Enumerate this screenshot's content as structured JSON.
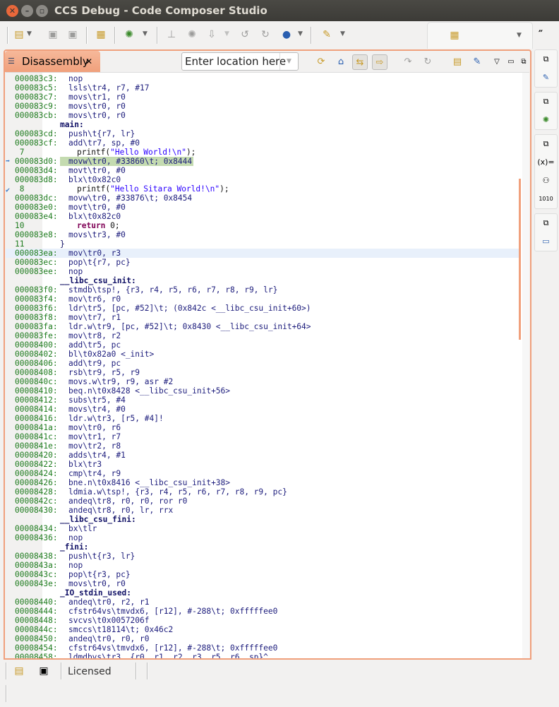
{
  "window": {
    "title": "CCS Debug - Code Composer Studio"
  },
  "view": {
    "tab_label": "Disassembly",
    "location_placeholder": "Enter location here"
  },
  "status": {
    "license": "Licensed"
  },
  "rows": [
    [
      "000083c3:",
      "nop",
      "i"
    ],
    [
      "000083c5:",
      "lsls\\tr4, r7, #17",
      "i"
    ],
    [
      "000083c7:",
      "movs\\tr1, r0",
      "i"
    ],
    [
      "000083c9:",
      "movs\\tr0, r0",
      "i"
    ],
    [
      "000083cb:",
      "movs\\tr0, r0",
      "i"
    ],
    [
      "",
      "main:",
      "l"
    ],
    [
      "000083cd:",
      "push\\t{r7, lr}",
      "i"
    ],
    [
      "000083cf:",
      "add\\tr7, sp, #0",
      "i"
    ],
    [
      " 7",
      "printf(\"Hello World!\\n\");",
      "s"
    ],
    [
      "000083d0:",
      "movw\\tr0, #33860\\t; 0x8444",
      "pc"
    ],
    [
      "000083d4:",
      "movt\\tr0, #0",
      "i"
    ],
    [
      "000083d8:",
      "blx\\t0x82c0",
      "i"
    ],
    [
      " 8",
      "printf(\"Hello Sitara World!\\n\");",
      "s"
    ],
    [
      "000083dc:",
      "movw\\tr0, #33876\\t; 0x8454",
      "i"
    ],
    [
      "000083e0:",
      "movt\\tr0, #0",
      "i"
    ],
    [
      "000083e4:",
      "blx\\t0x82c0",
      "i"
    ],
    [
      "10",
      "return 0;",
      "s"
    ],
    [
      "000083e8:",
      "movs\\tr3, #0",
      "i"
    ],
    [
      "11",
      "}",
      "b"
    ],
    [
      "000083ea:",
      "mov\\tr0, r3",
      "cur"
    ],
    [
      "000083ec:",
      "pop\\t{r7, pc}",
      "i"
    ],
    [
      "000083ee:",
      "nop",
      "i"
    ],
    [
      "",
      "__libc_csu_init:",
      "l"
    ],
    [
      "000083f0:",
      "stmdb\\tsp!, {r3, r4, r5, r6, r7, r8, r9, lr}",
      "i"
    ],
    [
      "000083f4:",
      "mov\\tr6, r0",
      "i"
    ],
    [
      "000083f6:",
      "ldr\\tr5, [pc, #52]\\t; (0x842c <__libc_csu_init+60>)",
      "i"
    ],
    [
      "000083f8:",
      "mov\\tr7, r1",
      "i"
    ],
    [
      "000083fa:",
      "ldr.w\\tr9, [pc, #52]\\t; 0x8430 <__libc_csu_init+64>",
      "i"
    ],
    [
      "000083fe:",
      "mov\\tr8, r2",
      "i"
    ],
    [
      "00008400:",
      "add\\tr5, pc",
      "i"
    ],
    [
      "00008402:",
      "bl\\t0x82a0 <_init>",
      "i"
    ],
    [
      "00008406:",
      "add\\tr9, pc",
      "i"
    ],
    [
      "00008408:",
      "rsb\\tr9, r5, r9",
      "i"
    ],
    [
      "0000840c:",
      "movs.w\\tr9, r9, asr #2",
      "i"
    ],
    [
      "00008410:",
      "beq.n\\t0x8428 <__libc_csu_init+56>",
      "i"
    ],
    [
      "00008412:",
      "subs\\tr5, #4",
      "i"
    ],
    [
      "00008414:",
      "movs\\tr4, #0",
      "i"
    ],
    [
      "00008416:",
      "ldr.w\\tr3, [r5, #4]!",
      "i"
    ],
    [
      "0000841a:",
      "mov\\tr0, r6",
      "i"
    ],
    [
      "0000841c:",
      "mov\\tr1, r7",
      "i"
    ],
    [
      "0000841e:",
      "mov\\tr2, r8",
      "i"
    ],
    [
      "00008420:",
      "adds\\tr4, #1",
      "i"
    ],
    [
      "00008422:",
      "blx\\tr3",
      "i"
    ],
    [
      "00008424:",
      "cmp\\tr4, r9",
      "i"
    ],
    [
      "00008426:",
      "bne.n\\t0x8416 <__libc_csu_init+38>",
      "i"
    ],
    [
      "00008428:",
      "ldmia.w\\tsp!, {r3, r4, r5, r6, r7, r8, r9, pc}",
      "i"
    ],
    [
      "0000842c:",
      "andeq\\tr8, r0, r0, ror r0",
      "i"
    ],
    [
      "00008430:",
      "andeq\\tr8, r0, lr, rrx",
      "i"
    ],
    [
      "",
      "__libc_csu_fini:",
      "l"
    ],
    [
      "00008434:",
      "bx\\tlr",
      "i"
    ],
    [
      "00008436:",
      "nop",
      "i"
    ],
    [
      "",
      "_fini:",
      "l"
    ],
    [
      "00008438:",
      "push\\t{r3, lr}",
      "i"
    ],
    [
      "0000843a:",
      "nop",
      "i"
    ],
    [
      "0000843c:",
      "pop\\t{r3, pc}",
      "i"
    ],
    [
      "0000843e:",
      "movs\\tr0, r0",
      "i"
    ],
    [
      "",
      "_IO_stdin_used:",
      "l"
    ],
    [
      "00008440:",
      "andeq\\tr0, r2, r1",
      "i"
    ],
    [
      "00008444:",
      "cfstr64vs\\tmvdx6, [r12], #-288\\t; 0xfffffee0",
      "i"
    ],
    [
      "00008448:",
      "svcvs\\t0x0057206f",
      "i"
    ],
    [
      "0000844c:",
      "smccs\\t18114\\t; 0x46c2",
      "i"
    ],
    [
      "00008450:",
      "andeq\\tr0, r0, r0",
      "i"
    ],
    [
      "00008454:",
      "cfstr64vs\\tmvdx6, [r12], #-288\\t; 0xfffffee0",
      "i"
    ],
    [
      "00008458:",
      "ldmdbvs\\tr3, {r0, r1, r2, r3, r5, r6, sp}^",
      "i"
    ]
  ],
  "colors": {
    "accent": "#f0a07c",
    "pc_highlight": "#c4dbb0",
    "address": "#1f7c1f"
  }
}
